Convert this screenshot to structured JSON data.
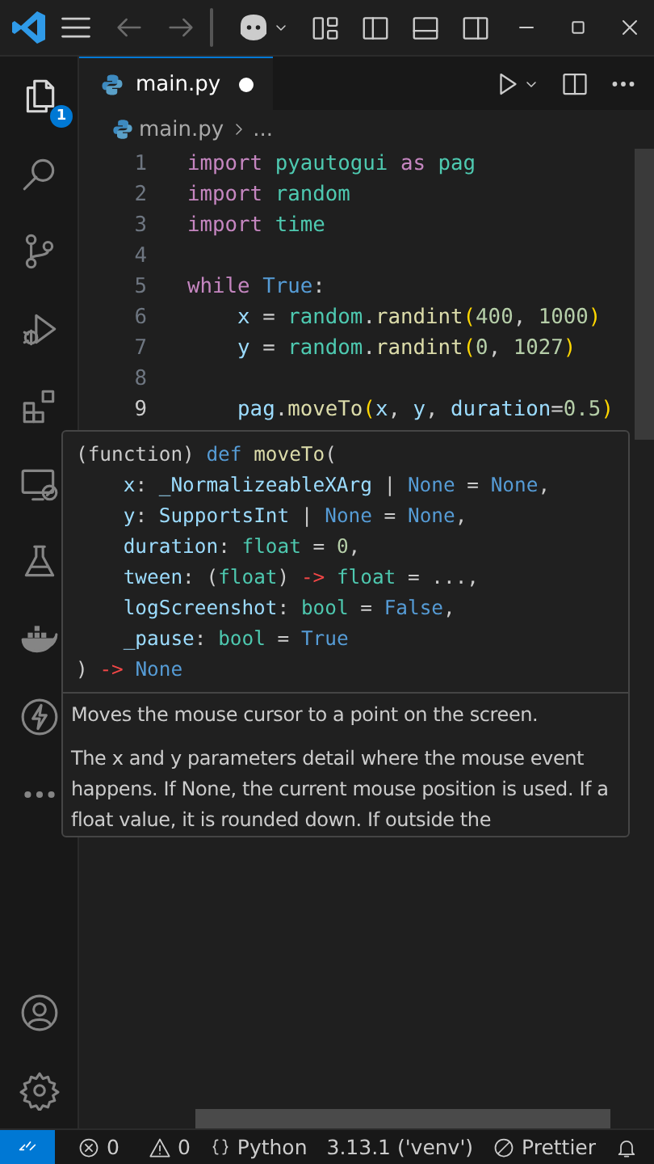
{
  "activity_bar": {
    "items": [
      {
        "selected": true,
        "badge": "1"
      },
      {
        "selected": false
      },
      {
        "selected": false
      },
      {
        "selected": false
      },
      {
        "selected": false
      },
      {
        "selected": false
      },
      {
        "selected": false
      },
      {
        "selected": false
      },
      {
        "selected": false
      },
      {
        "selected": false
      }
    ],
    "bottom_items": [
      {
        "selected": false
      },
      {
        "selected": false
      }
    ]
  },
  "tabs": [
    {
      "label": "main.py",
      "selected": true,
      "modified": true
    }
  ],
  "breadcrumb": [
    "main.py",
    "..."
  ],
  "editor": {
    "lines": [
      {
        "number": "1",
        "current": false,
        "tokens": [
          {
            "kind": "kw",
            "text": "import "
          },
          {
            "kind": "mod",
            "text": "pyautogui "
          },
          {
            "kind": "kw",
            "text": "as "
          },
          {
            "kind": "mod",
            "text": "pag"
          }
        ]
      },
      {
        "number": "2",
        "current": false,
        "tokens": [
          {
            "kind": "kw",
            "text": "import "
          },
          {
            "kind": "mod",
            "text": "random"
          }
        ]
      },
      {
        "number": "3",
        "current": false,
        "tokens": [
          {
            "kind": "kw",
            "text": "import "
          },
          {
            "kind": "mod",
            "text": "time"
          }
        ]
      },
      {
        "number": "4",
        "current": false
      },
      {
        "number": "5",
        "current": false,
        "tokens": [
          {
            "kind": "kw",
            "text": "while "
          },
          {
            "kind": "const",
            "text": "True"
          },
          {
            "kind": "op",
            "text": ":"
          }
        ]
      },
      {
        "number": "6",
        "current": false,
        "tokens": [
          {
            "kind": "var",
            "text": "    x"
          },
          {
            "kind": "op",
            "text": " = "
          },
          {
            "kind": "mod",
            "text": "random"
          },
          {
            "kind": "op",
            "text": "."
          },
          {
            "kind": "fn",
            "text": "randint"
          },
          {
            "kind": "bracket",
            "text": "("
          },
          {
            "kind": "num",
            "text": "400"
          },
          {
            "kind": "op",
            "text": ", "
          },
          {
            "kind": "num",
            "text": "1000"
          },
          {
            "kind": "bracket",
            "text": ")"
          }
        ]
      },
      {
        "number": "7",
        "current": false,
        "tokens": [
          {
            "kind": "var",
            "text": "    y"
          },
          {
            "kind": "op",
            "text": " = "
          },
          {
            "kind": "mod",
            "text": "random"
          },
          {
            "kind": "op",
            "text": "."
          },
          {
            "kind": "fn",
            "text": "randint"
          },
          {
            "kind": "bracket",
            "text": "("
          },
          {
            "kind": "num",
            "text": "0"
          },
          {
            "kind": "op",
            "text": ", "
          },
          {
            "kind": "num",
            "text": "1027"
          },
          {
            "kind": "bracket",
            "text": ")"
          }
        ]
      },
      {
        "number": "8",
        "current": false
      },
      {
        "number": "9",
        "current": true,
        "tokens": [
          {
            "kind": "var",
            "text": "    pag"
          },
          {
            "kind": "op",
            "text": "."
          },
          {
            "kind": "fn",
            "text": "moveTo"
          },
          {
            "kind": "bracket",
            "text": "("
          },
          {
            "kind": "var",
            "text": "x"
          },
          {
            "kind": "op",
            "text": ", "
          },
          {
            "kind": "var",
            "text": "y"
          },
          {
            "kind": "op",
            "text": ", "
          },
          {
            "kind": "var",
            "text": "duration"
          },
          {
            "kind": "op",
            "text": "="
          },
          {
            "kind": "num",
            "text": "0.5"
          },
          {
            "kind": "bracket",
            "text": ")"
          }
        ]
      }
    ]
  },
  "hover": {
    "signature": [
      [
        {
          "kind": "op",
          "text": "(function) "
        },
        {
          "kind": "const",
          "text": "def "
        },
        {
          "kind": "fn",
          "text": "moveTo"
        },
        {
          "kind": "op",
          "text": "("
        }
      ],
      [
        {
          "kind": "var",
          "text": "    x"
        },
        {
          "kind": "op",
          "text": ": "
        },
        {
          "kind": "var",
          "text": "_NormalizeableXArg"
        },
        {
          "kind": "op",
          "text": " | "
        },
        {
          "kind": "const",
          "text": "None"
        },
        {
          "kind": "op",
          "text": " = "
        },
        {
          "kind": "const",
          "text": "None"
        },
        {
          "kind": "op",
          "text": ","
        }
      ],
      [
        {
          "kind": "var",
          "text": "    y"
        },
        {
          "kind": "op",
          "text": ": "
        },
        {
          "kind": "var",
          "text": "SupportsInt"
        },
        {
          "kind": "op",
          "text": " | "
        },
        {
          "kind": "const",
          "text": "None"
        },
        {
          "kind": "op",
          "text": " = "
        },
        {
          "kind": "const",
          "text": "None"
        },
        {
          "kind": "op",
          "text": ","
        }
      ],
      [
        {
          "kind": "var",
          "text": "    duration"
        },
        {
          "kind": "op",
          "text": ": "
        },
        {
          "kind": "mod",
          "text": "float"
        },
        {
          "kind": "op",
          "text": " = "
        },
        {
          "kind": "num",
          "text": "0"
        },
        {
          "kind": "op",
          "text": ","
        }
      ],
      [
        {
          "kind": "var",
          "text": "    tween"
        },
        {
          "kind": "op",
          "text": ": ("
        },
        {
          "kind": "mod",
          "text": "float"
        },
        {
          "kind": "op",
          "text": ") "
        },
        {
          "kind": "arrow",
          "text": "-> "
        },
        {
          "kind": "mod",
          "text": "float"
        },
        {
          "kind": "op",
          "text": " = ...,"
        }
      ],
      [
        {
          "kind": "var",
          "text": "    logScreenshot"
        },
        {
          "kind": "op",
          "text": ": "
        },
        {
          "kind": "mod",
          "text": "bool"
        },
        {
          "kind": "op",
          "text": " = "
        },
        {
          "kind": "const",
          "text": "False"
        },
        {
          "kind": "op",
          "text": ","
        }
      ],
      [
        {
          "kind": "var",
          "text": "    _pause"
        },
        {
          "kind": "op",
          "text": ": "
        },
        {
          "kind": "mod",
          "text": "bool"
        },
        {
          "kind": "op",
          "text": " = "
        },
        {
          "kind": "const",
          "text": "True"
        }
      ],
      [
        {
          "kind": "op",
          "text": ") "
        },
        {
          "kind": "arrow",
          "text": "-> "
        },
        {
          "kind": "const",
          "text": "None"
        }
      ]
    ],
    "paragraphs": [
      "Moves the mouse cursor to a point on the screen.",
      "The x and y parameters detail where the mouse event happens. If None, the current mouse position is used. If a float value, it is rounded down. If outside the"
    ]
  },
  "status_bar": {
    "errors": "0",
    "warnings": "0",
    "language": "Python",
    "interpreter": "3.13.1 ('venv')",
    "formatter": "Prettier"
  }
}
